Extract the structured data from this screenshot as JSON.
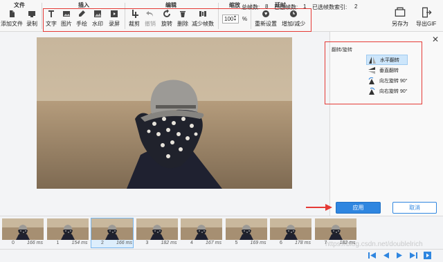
{
  "toolbar": {
    "groups": {
      "file": "文件",
      "insert": "插入",
      "edit": "编辑",
      "zoom": "缩放",
      "delay": "延时"
    },
    "file_buttons": [
      {
        "label": "添加文件",
        "icon": "add-file-icon"
      },
      {
        "label": "录制",
        "icon": "record-icon"
      }
    ],
    "insert_buttons": [
      {
        "label": "文字",
        "icon": "text-icon"
      },
      {
        "label": "图片",
        "icon": "image-icon"
      },
      {
        "label": "手绘",
        "icon": "pen-icon"
      },
      {
        "label": "水印",
        "icon": "watermark-icon"
      },
      {
        "label": "录屏",
        "icon": "screen-record-icon"
      }
    ],
    "edit_buttons": [
      {
        "label": "裁剪",
        "icon": "crop-icon"
      },
      {
        "label": "撤销",
        "icon": "undo-icon",
        "disabled": true
      },
      {
        "label": "旋转",
        "icon": "rotate-icon"
      },
      {
        "label": "删除",
        "icon": "trash-icon"
      },
      {
        "label": "减少帧数",
        "icon": "reduce-frames-icon"
      }
    ],
    "zoom_value": "100",
    "zoom_unit": "%",
    "delay_buttons": [
      {
        "label": "重新设置",
        "icon": "reset-icon"
      },
      {
        "label": "增加/减少",
        "icon": "clock-icon"
      }
    ],
    "right_buttons": [
      {
        "label": "另存为",
        "icon": "save-as-icon"
      },
      {
        "label": "导出GIF",
        "icon": "export-gif-icon"
      }
    ]
  },
  "rotate_panel": {
    "title": "翻转/旋转",
    "options": [
      {
        "label": "水平翻转",
        "icon": "flip-horizontal-icon",
        "selected": true
      },
      {
        "label": "垂直翻转",
        "icon": "flip-vertical-icon",
        "selected": false
      },
      {
        "label": "向左旋转 90°",
        "icon": "rotate-left-icon",
        "selected": false
      },
      {
        "label": "向右旋转 90°",
        "icon": "rotate-right-icon",
        "selected": false
      }
    ],
    "apply": "应用",
    "cancel": "取消"
  },
  "frames": [
    {
      "index": "0",
      "ms": "166 ms"
    },
    {
      "index": "1",
      "ms": "154 ms"
    },
    {
      "index": "2",
      "ms": "166 ms"
    },
    {
      "index": "3",
      "ms": "182 ms"
    },
    {
      "index": "4",
      "ms": "167 ms"
    },
    {
      "index": "5",
      "ms": "169 ms"
    },
    {
      "index": "6",
      "ms": "178 ms"
    },
    {
      "index": "7",
      "ms": "182 ms"
    }
  ],
  "selected_frame": 2,
  "status": {
    "total_label": "总帧数:",
    "total": "8",
    "selected_label": "已选帧数:",
    "selected": "1",
    "selected_index_label": "已选帧数索引:",
    "selected_index": "2"
  },
  "watermark": "https://blog.csdn.net/doublelrich",
  "colors": {
    "accent": "#2f86e0",
    "highlight": "#e53935",
    "selection": "#cde6fb"
  }
}
